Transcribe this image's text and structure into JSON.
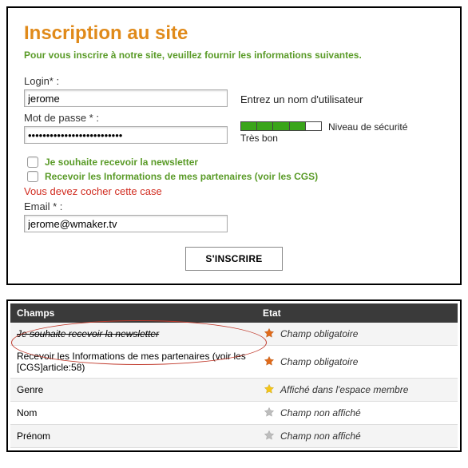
{
  "form": {
    "title": "Inscription au site",
    "subtitle": "Pour vous inscrire à notre site, veuillez fournir les informations suivantes.",
    "login_label": "Login* :",
    "login_value": "jerome",
    "login_hint": "Entrez un nom d'utilisateur",
    "password_label": "Mot de passe * :",
    "password_value": "••••••••••••••••••••••••••",
    "strength_label": "Niveau de sécurité",
    "strength_text": "Très bon",
    "cb_newsletter": "Je souhaite recevoir la newsletter",
    "cb_partners_prefix": "Recevoir les Informations de mes partenaires (voir les ",
    "cb_partners_link": "CGS",
    "cb_partners_suffix": ")",
    "error": "Vous devez cocher cette case",
    "email_label": "Email * :",
    "email_value": "jerome@wmaker.tv",
    "submit": "S'INSCRIRE"
  },
  "table": {
    "col_champs": "Champs",
    "col_etat": "Etat",
    "rows": [
      {
        "champ": "Je souhaite recevoir la newsletter",
        "etat": "Champ obligatoire",
        "icon": "orange"
      },
      {
        "champ": "Recevoir les Informations de mes partenaires (voir les [CGS]article:58)",
        "etat": "Champ obligatoire",
        "icon": "orange"
      },
      {
        "champ": "Genre",
        "etat": "Affiché dans l'espace membre",
        "icon": "yellow"
      },
      {
        "champ": "Nom",
        "etat": "Champ non affiché",
        "icon": "grey"
      },
      {
        "champ": "Prénom",
        "etat": "Champ non affiché",
        "icon": "grey"
      }
    ]
  }
}
